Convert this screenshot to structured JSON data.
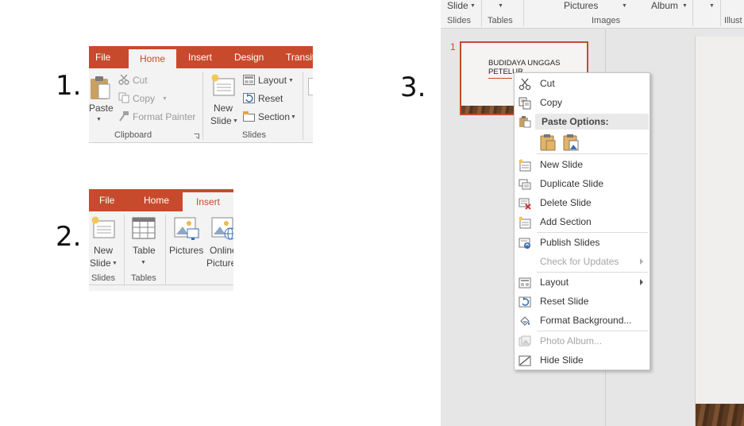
{
  "steps": {
    "one": "1.",
    "two": "2.",
    "three": "3."
  },
  "panel1": {
    "tabs": [
      "File",
      "Home",
      "Insert",
      "Design",
      "Transit"
    ],
    "active_tab": "Home",
    "paste": "Paste",
    "cut": "Cut",
    "copy": "Copy",
    "format_painter": "Format Painter",
    "new": "New",
    "slide": "Slide",
    "layout": "Layout",
    "reset": "Reset",
    "section": "Section",
    "groups": [
      "Clipboard",
      "Slides"
    ]
  },
  "panel2": {
    "tabs": [
      "File",
      "Home",
      "Insert"
    ],
    "active_tab": "Insert",
    "new": "New",
    "slide": "Slide",
    "table": "Table",
    "pictures": "Pictures",
    "online": "Online",
    "online_pictures": "Picture",
    "groups": [
      "Slides",
      "Tables"
    ]
  },
  "panel3": {
    "ribbon": {
      "slide": "Slide",
      "pictures": "Pictures",
      "album": "Album",
      "groups": [
        "Slides",
        "Tables",
        "Images",
        "Illust"
      ]
    },
    "slide_number": "1",
    "thumb_title_line1": "BUDIDAYA  UNGGAS",
    "thumb_title_line2": "PETELUR",
    "menu": {
      "cut": "Cut",
      "copy": "Copy",
      "paste_options": "Paste Options:",
      "new_slide": "New Slide",
      "duplicate_slide": "Duplicate Slide",
      "delete_slide": "Delete Slide",
      "add_section": "Add Section",
      "publish_slides": "Publish Slides",
      "check_for_updates": "Check for Updates",
      "layout": "Layout",
      "reset_slide": "Reset Slide",
      "format_background": "Format Background...",
      "photo_album": "Photo Album...",
      "hide_slide": "Hide Slide"
    }
  },
  "colors": {
    "accent": "#c84a2c",
    "ribbon_bg": "#f3f3f3"
  }
}
